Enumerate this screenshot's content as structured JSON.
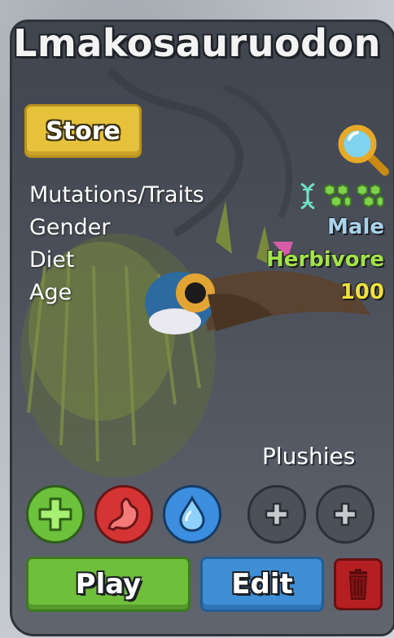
{
  "creature": {
    "name": "Lmakosauruodon"
  },
  "toolbar": {
    "store_label": "Store",
    "search_icon": "magnifier-icon"
  },
  "stats": {
    "mutations_label": "Mutations/Traits",
    "gender_label": "Gender",
    "gender_value": "Male",
    "diet_label": "Diet",
    "diet_value": "Herbivore",
    "age_label": "Age",
    "age_value": "100",
    "trait_icons": [
      "dna-icon",
      "cluster-trait-icon",
      "cluster-trait-icon"
    ]
  },
  "plushies": {
    "label": "Plushies",
    "slots": [
      "add-plushie-icon",
      "add-plushie-icon"
    ]
  },
  "actions": {
    "heal_icon": "plus-icon",
    "food_icon": "stomach-icon",
    "water_icon": "water-drop-icon",
    "play_label": "Play",
    "edit_label": "Edit",
    "delete_icon": "trash-icon"
  },
  "colors": {
    "gender_value": "#a9d3ea",
    "diet_value": "#a3e24a",
    "age_value": "#f1df3c",
    "store_button": "#e6c23a",
    "play_button": "#6fbf3a",
    "edit_button": "#3e8fd6",
    "delete_button": "#b51f22"
  }
}
